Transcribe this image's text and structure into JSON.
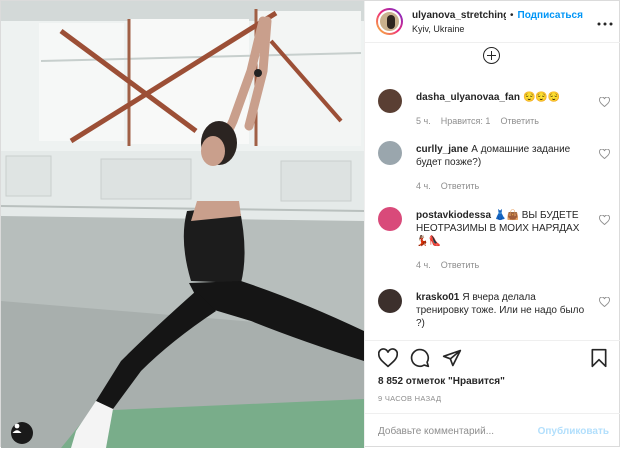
{
  "post": {
    "author": {
      "username": "ulyanova_stretching",
      "follow_label": "Подписаться",
      "dot": "•",
      "location": "Kyiv, Ukraine",
      "more_icon": "more-horizontal-icon"
    },
    "photo": {
      "icon": "user-tag-icon"
    },
    "load_more_icon": "plus-circle-icon",
    "comments": [
      {
        "username": "dasha_ulyanovaa_fan",
        "text": "😌😌😌",
        "time": "5 ч.",
        "likes": "Нравится: 1",
        "reply": "Ответить",
        "avatar_color": "#5a3f33"
      },
      {
        "username": "curlly_jane",
        "text": "А домашние задание будет позже?)",
        "time": "4 ч.",
        "likes": "",
        "reply": "Ответить",
        "avatar_color": "#9aa6ad"
      },
      {
        "username": "postavkiodessa",
        "text": "👗👜 ВЫ БУДЕТЕ НЕОТРАЗИМЫ В МОИХ НАРЯДАХ💃🏽👠",
        "time": "4 ч.",
        "likes": "",
        "reply": "Ответить",
        "avatar_color": "#d94a7a"
      },
      {
        "username": "krasko01",
        "text": "Я вчера делала тренировку тоже. Или не надо было ?)",
        "time": "",
        "likes": "",
        "reply": "",
        "avatar_color": "#3c302c"
      }
    ],
    "actions": {
      "like_icon": "heart-icon",
      "comment_icon": "comment-icon",
      "share_icon": "share-icon",
      "save_icon": "bookmark-icon"
    },
    "likes_text": "8 852 отметок \"Нравится\"",
    "timestamp": "9 ЧАСОВ НАЗАД",
    "add_comment": {
      "placeholder": "Добавьте комментарий...",
      "post_label": "Опубликовать"
    }
  }
}
